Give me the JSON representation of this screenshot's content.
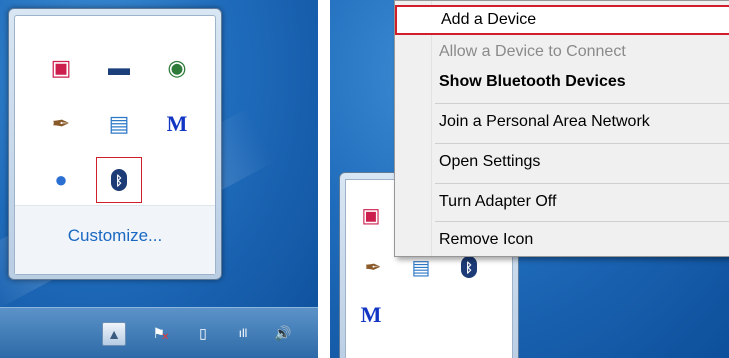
{
  "left_flyout": {
    "icons": [
      {
        "name": "monitor-red-icon",
        "glyph": "▣",
        "color": "#cc1f4e"
      },
      {
        "name": "display-icon",
        "glyph": "▬",
        "color": "#1a3f7a"
      },
      {
        "name": "globe-close-icon",
        "glyph": "◉",
        "color": "#2f7b3a"
      },
      {
        "name": "pen-tool-icon",
        "glyph": "✒",
        "color": "#8a5a2a"
      },
      {
        "name": "document-icon",
        "glyph": "▤",
        "color": "#2e78c8"
      },
      {
        "name": "m-logo-icon",
        "glyph": "M",
        "color": "#1235c4"
      },
      {
        "name": "blue-orb-icon",
        "glyph": "●",
        "color": "#2a6fd1"
      },
      {
        "name": "bluetooth-icon",
        "glyph": "ᛒ",
        "color": "#ffffff"
      }
    ],
    "customize_label": "Customize..."
  },
  "taskbar": {
    "icons": [
      {
        "name": "show-hidden-icons-button",
        "glyph": "▲"
      },
      {
        "name": "action-center-flag-icon",
        "glyph": "⚑"
      },
      {
        "name": "battery-icon",
        "glyph": "▯"
      },
      {
        "name": "signal-icon",
        "glyph": "ıll"
      },
      {
        "name": "volume-icon",
        "glyph": "🔊"
      }
    ]
  },
  "context_menu": {
    "items": [
      {
        "label": "Add a Device",
        "state": "highlighted"
      },
      {
        "label": "Allow a Device to Connect",
        "state": "disabled"
      },
      {
        "label": "Show Bluetooth Devices",
        "state": "bold"
      },
      {
        "label": "Join a Personal Area Network",
        "state": "normal"
      },
      {
        "label": "Open Settings",
        "state": "normal"
      },
      {
        "label": "Turn Adapter Off",
        "state": "normal"
      },
      {
        "label": "Remove Icon",
        "state": "normal"
      }
    ]
  },
  "colors": {
    "highlight_outline": "#d01f2a",
    "link": "#1a68c2"
  }
}
